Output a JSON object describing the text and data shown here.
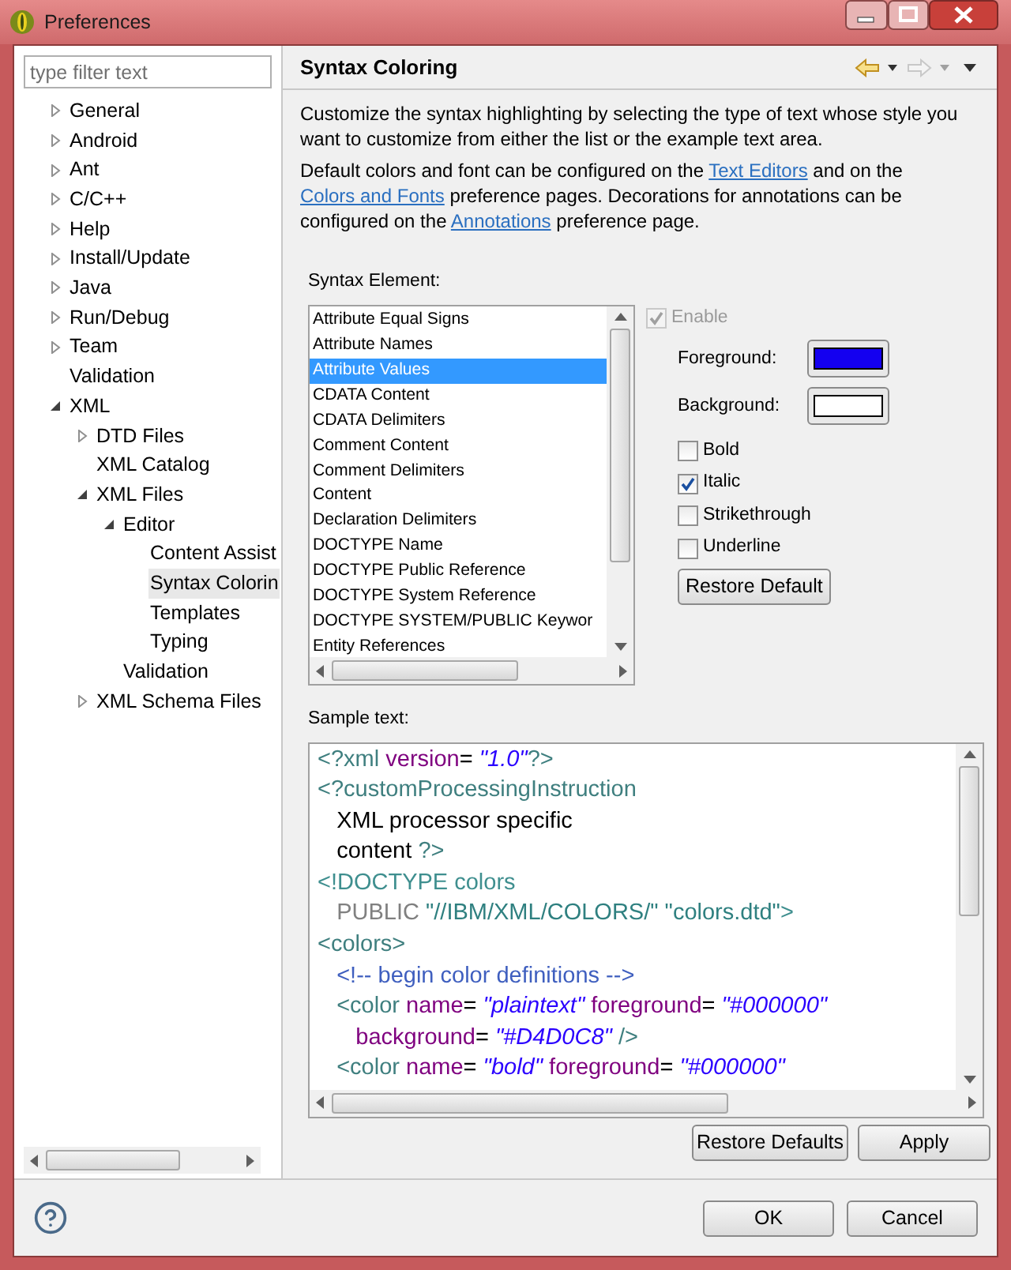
{
  "window": {
    "title": "Preferences"
  },
  "filter": {
    "placeholder": "type filter text"
  },
  "tree": [
    {
      "label": "General",
      "expanded": false,
      "selected": false
    },
    {
      "label": "Android",
      "expanded": false,
      "selected": false
    },
    {
      "label": "Ant",
      "expanded": false,
      "selected": false
    },
    {
      "label": "C/C++",
      "expanded": false,
      "selected": false
    },
    {
      "label": "Help",
      "expanded": false,
      "selected": false
    },
    {
      "label": "Install/Update",
      "expanded": false,
      "selected": false
    },
    {
      "label": "Java",
      "expanded": false,
      "selected": false
    },
    {
      "label": "Run/Debug",
      "expanded": false,
      "selected": false
    },
    {
      "label": "Team",
      "expanded": false,
      "selected": false
    },
    {
      "label": "Validation",
      "selected": false
    },
    {
      "label": "XML",
      "expanded": true,
      "selected": false,
      "children": [
        {
          "label": "DTD Files",
          "expanded": false,
          "selected": false
        },
        {
          "label": "XML Catalog",
          "selected": false
        },
        {
          "label": "XML Files",
          "expanded": true,
          "selected": false,
          "children": [
            {
              "label": "Editor",
              "expanded": true,
              "selected": false,
              "children": [
                {
                  "label": "Content Assist",
                  "selected": false
                },
                {
                  "label": "Syntax Colorin",
                  "selected": true
                },
                {
                  "label": "Templates",
                  "selected": false
                },
                {
                  "label": "Typing",
                  "selected": false
                }
              ]
            },
            {
              "label": "Validation",
              "selected": false
            }
          ]
        },
        {
          "label": "XML Schema Files",
          "expanded": false,
          "selected": false
        }
      ]
    }
  ],
  "page": {
    "title": "Syntax Coloring",
    "description": [
      [
        {
          "text": "Customize the syntax highlighting by selecting the type of text whose style you want to customize from either the list or the example text area."
        }
      ],
      [
        {
          "text": "Default colors and font can be configured on the "
        },
        {
          "text": "Text Editors",
          "link": true
        },
        {
          "text": " and on the "
        },
        {
          "text": "Colors and Fonts",
          "link": true
        },
        {
          "text": " preference pages.  Decorations for annotations can be configured on the "
        },
        {
          "text": "Annotations",
          "link": true
        },
        {
          "text": " preference page."
        }
      ]
    ],
    "syntax_element_label": "Syntax Element:",
    "syntax_elements": [
      {
        "label": "Attribute Equal Signs",
        "selected": false
      },
      {
        "label": "Attribute Names",
        "selected": false
      },
      {
        "label": "Attribute Values",
        "selected": true
      },
      {
        "label": "CDATA Content",
        "selected": false
      },
      {
        "label": "CDATA Delimiters",
        "selected": false
      },
      {
        "label": "Comment Content",
        "selected": false
      },
      {
        "label": "Comment Delimiters",
        "selected": false
      },
      {
        "label": "Content",
        "selected": false
      },
      {
        "label": "Declaration Delimiters",
        "selected": false
      },
      {
        "label": "DOCTYPE Name",
        "selected": false
      },
      {
        "label": "DOCTYPE Public Reference",
        "selected": false
      },
      {
        "label": "DOCTYPE System Reference",
        "selected": false
      },
      {
        "label": "DOCTYPE SYSTEM/PUBLIC Keywor",
        "selected": false
      },
      {
        "label": "Entity References",
        "selected": false
      }
    ],
    "enable": {
      "label": "Enable",
      "checked": true,
      "disabled": true
    },
    "foreground": {
      "label": "Foreground:",
      "color": "#1400f0"
    },
    "background": {
      "label": "Background:",
      "color": "#ffffff"
    },
    "styles": [
      {
        "label": "Bold",
        "checked": false
      },
      {
        "label": "Italic",
        "checked": true
      },
      {
        "label": "Strikethrough",
        "checked": false
      },
      {
        "label": "Underline",
        "checked": false
      }
    ],
    "restore_default": "Restore Default",
    "sample_label": "Sample text:",
    "sample": [
      [
        {
          "text": "<?xml ",
          "kind": "pi"
        },
        {
          "text": "version",
          "kind": "attr"
        },
        {
          "text": "= ",
          "kind": "plain"
        },
        {
          "text": "\"1.0\"",
          "kind": "value"
        },
        {
          "text": "?>",
          "kind": "pi"
        }
      ],
      [
        {
          "text": "<?customProcessingInstruction",
          "kind": "pi"
        }
      ],
      [
        {
          "text": "   XML processor specific",
          "kind": "plain"
        }
      ],
      [
        {
          "text": "   content ",
          "kind": "plain"
        },
        {
          "text": "?>",
          "kind": "pi"
        }
      ],
      [
        {
          "text": "<!DOCTYPE colors",
          "kind": "doctype"
        }
      ],
      [
        {
          "text": "   PUBLIC ",
          "kind": "keyword"
        },
        {
          "text": "\"//IBM/XML/COLORS/\" \"colors.dtd\"",
          "kind": "string"
        },
        {
          "text": ">",
          "kind": "doctype"
        }
      ],
      [
        {
          "text": "<colors>",
          "kind": "tag"
        }
      ],
      [
        {
          "text": "   <!-- begin color definitions -->",
          "kind": "comment"
        }
      ],
      [
        {
          "text": "   <color ",
          "kind": "tag"
        },
        {
          "text": "name",
          "kind": "attr"
        },
        {
          "text": "= ",
          "kind": "plain"
        },
        {
          "text": "\"plaintext\"",
          "kind": "value"
        },
        {
          "text": " foreground",
          "kind": "attr"
        },
        {
          "text": "= ",
          "kind": "plain"
        },
        {
          "text": "\"#000000\"",
          "kind": "value"
        }
      ],
      [
        {
          "text": "      background",
          "kind": "attr"
        },
        {
          "text": "= ",
          "kind": "plain"
        },
        {
          "text": "\"#D4D0C8\"",
          "kind": "value"
        },
        {
          "text": " />",
          "kind": "tag"
        }
      ],
      [
        {
          "text": "   <color ",
          "kind": "tag"
        },
        {
          "text": "name",
          "kind": "attr"
        },
        {
          "text": "= ",
          "kind": "plain"
        },
        {
          "text": "\"bold\"",
          "kind": "value"
        },
        {
          "text": " foreground",
          "kind": "attr"
        },
        {
          "text": "= ",
          "kind": "plain"
        },
        {
          "text": "\"#000000\"",
          "kind": "value"
        }
      ]
    ],
    "restore_defaults": "Restore Defaults",
    "apply": "Apply"
  },
  "buttons": {
    "ok": "OK",
    "cancel": "Cancel"
  }
}
